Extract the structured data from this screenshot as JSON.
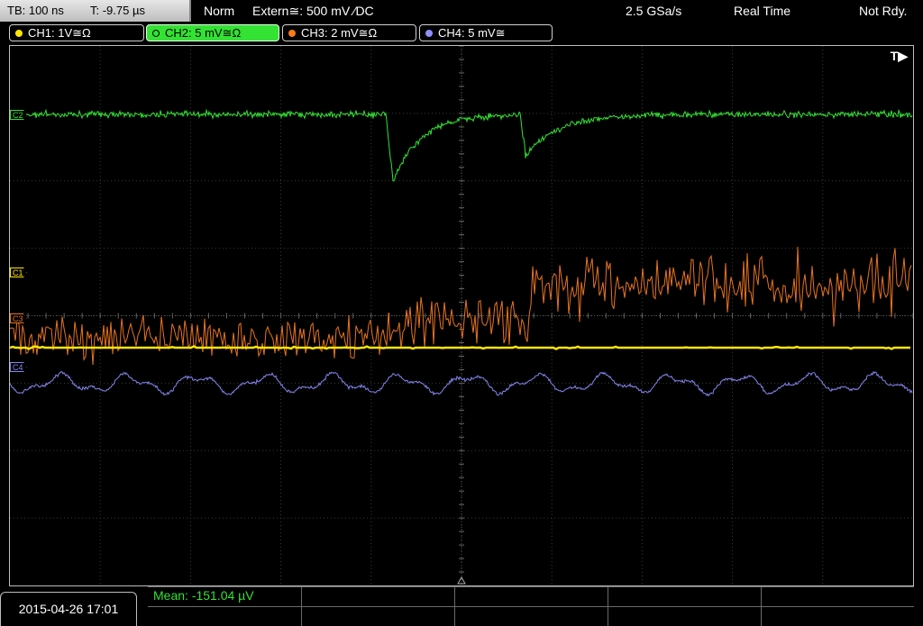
{
  "topbar": {
    "timebase": "TB: 100 ns",
    "trigger_time": "T: -9.75 µs",
    "trigger_mode": "Norm",
    "trigger_source": "Extern≅: 500 mV ⁄DC",
    "sample_rate": "2.5 GSa/s",
    "acq_mode": "Real Time",
    "status": "Not Rdy."
  },
  "channels": [
    {
      "label": "CH1: 1V≅Ω",
      "color": "#ffe600"
    },
    {
      "label": "CH2: 5 mV≅Ω",
      "color": "#33e233"
    },
    {
      "label": "CH3: 2 mV≅Ω",
      "color": "#ff7a1a"
    },
    {
      "label": "CH4: 5 mV≅",
      "color": "#8f8fff"
    }
  ],
  "markers": {
    "c1": "C1",
    "c3": "C3",
    "c4": "C4",
    "c2": "C2"
  },
  "trigger_label": "T▶",
  "datetime": "2015-04-26 17:01",
  "measurement": {
    "label": "Mean:",
    "value": "-151.04 µV"
  },
  "colors": {
    "ch1": "#ffe600",
    "ch2": "#33e233",
    "ch3": "#e8741f",
    "ch4": "#8585ee",
    "grid": "#3a3a3a"
  }
}
